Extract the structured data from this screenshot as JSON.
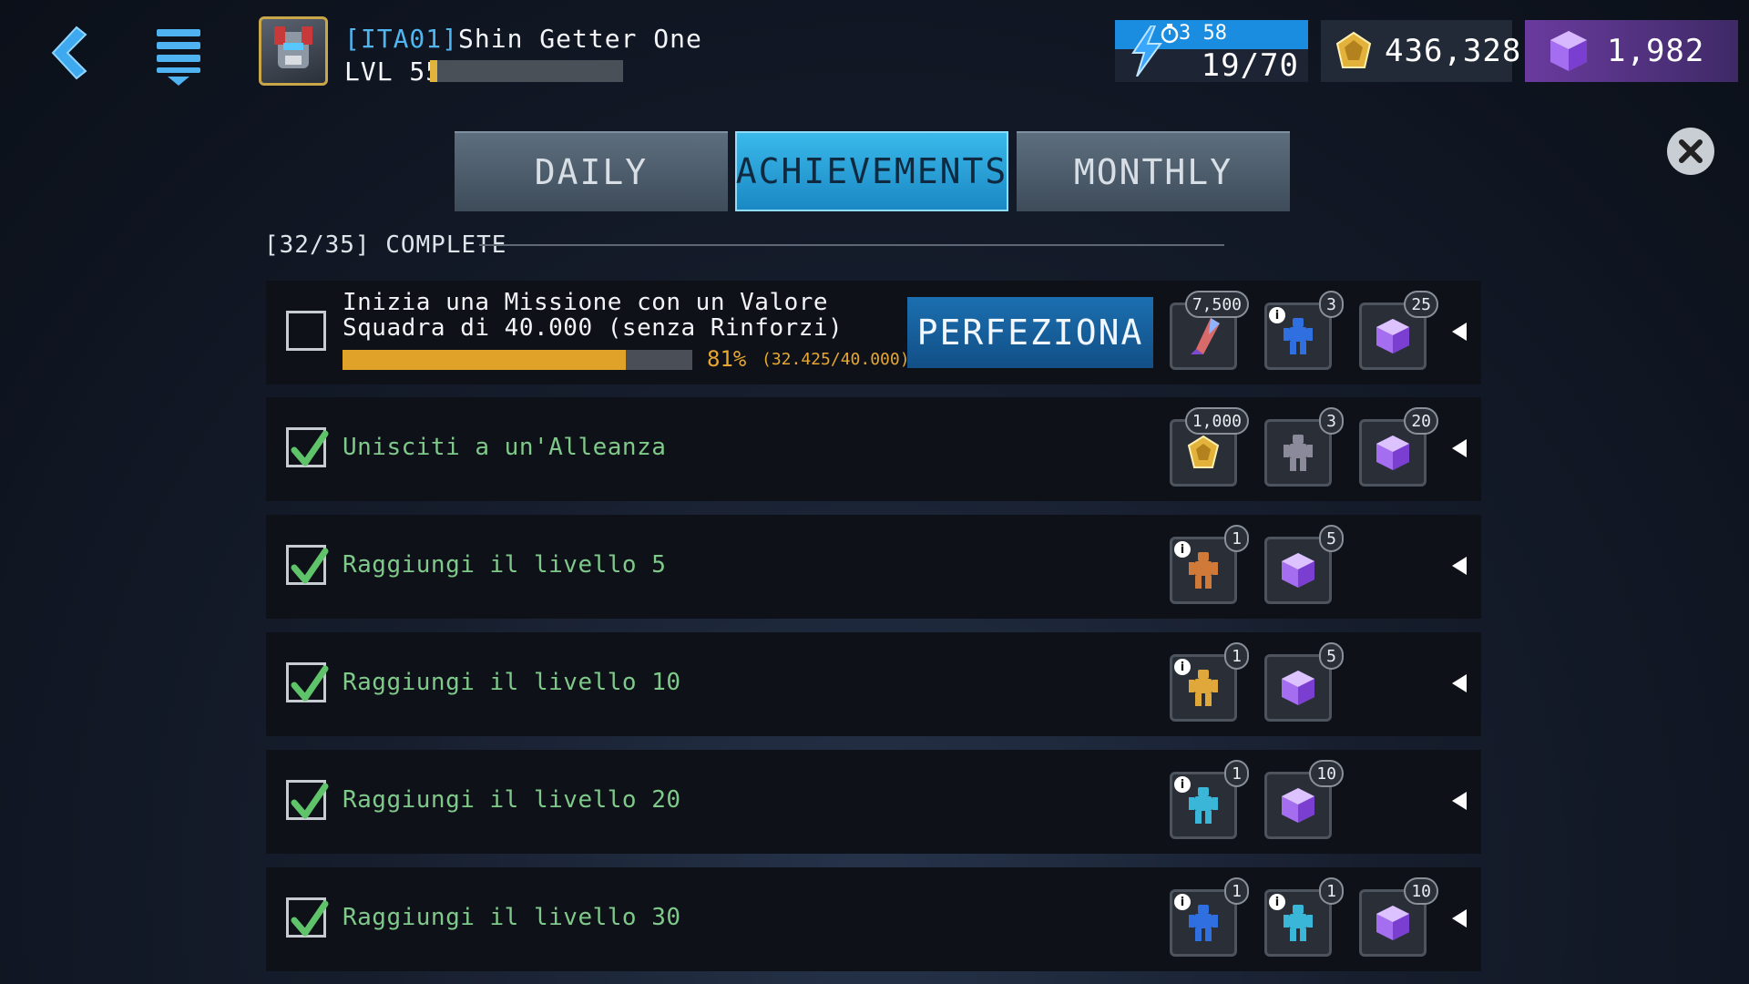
{
  "header": {
    "alliance_tag": "[ITA01]",
    "player_name": "Shin Getter One",
    "level_label": "LVL 55",
    "xp_fraction": 0.04,
    "energy_timer": "3 58",
    "energy_value": "19/70",
    "gold_value": "436,328",
    "gems_value": "1,982"
  },
  "tabs": [
    {
      "label": "DAILY",
      "active": false
    },
    {
      "label": "ACHIEVEMENTS",
      "active": true
    },
    {
      "label": "MONTHLY",
      "active": false
    }
  ],
  "summary": {
    "complete_label": "[32/35] COMPLETE"
  },
  "achievements": [
    {
      "title": "Inizia una Missione con un Valore Squadra di 40.000 (senza Rinforzi)",
      "done": false,
      "progress_pct": "81%",
      "progress_raw": "(32.425/40.000)",
      "progress_fraction": 0.81,
      "action_label": "PERFEZIONA",
      "rewards": [
        {
          "icon": "shard-icon",
          "count": "7,500",
          "info": false
        },
        {
          "icon": "bot-icon-blue",
          "count": "3",
          "info": true
        },
        {
          "icon": "energon-cube-icon",
          "count": "25",
          "info": false
        }
      ]
    },
    {
      "title": "Unisciti a un'Alleanza",
      "done": true,
      "rewards": [
        {
          "icon": "gold-icon",
          "count": "1,000",
          "info": false
        },
        {
          "icon": "bot-icon-grey",
          "count": "3",
          "info": false
        },
        {
          "icon": "energon-cube-icon",
          "count": "20",
          "info": false
        }
      ]
    },
    {
      "title": "Raggiungi il livello 5",
      "done": true,
      "rewards": [
        {
          "icon": "bot-icon-orange",
          "count": "1",
          "info": true
        },
        {
          "icon": "energon-cube-icon",
          "count": "5",
          "info": false
        }
      ]
    },
    {
      "title": "Raggiungi il livello 10",
      "done": true,
      "rewards": [
        {
          "icon": "bot-icon-yellow",
          "count": "1",
          "info": true
        },
        {
          "icon": "energon-cube-icon",
          "count": "5",
          "info": false
        }
      ]
    },
    {
      "title": "Raggiungi il livello 20",
      "done": true,
      "rewards": [
        {
          "icon": "bot-icon-cyan",
          "count": "1",
          "info": true
        },
        {
          "icon": "energon-cube-icon",
          "count": "10",
          "info": false
        }
      ]
    },
    {
      "title": "Raggiungi il livello 30",
      "done": true,
      "rewards": [
        {
          "icon": "bot-icon-blue",
          "count": "1",
          "info": true
        },
        {
          "icon": "bot-icon-cyan",
          "count": "1",
          "info": true
        },
        {
          "icon": "energon-cube-icon",
          "count": "10",
          "info": false
        }
      ]
    }
  ],
  "colors": {
    "accent_blue": "#1a8de0",
    "done_green": "#7fc98a",
    "progress_orange": "#e1a22a",
    "gem_purple": "#8a4fd8"
  }
}
